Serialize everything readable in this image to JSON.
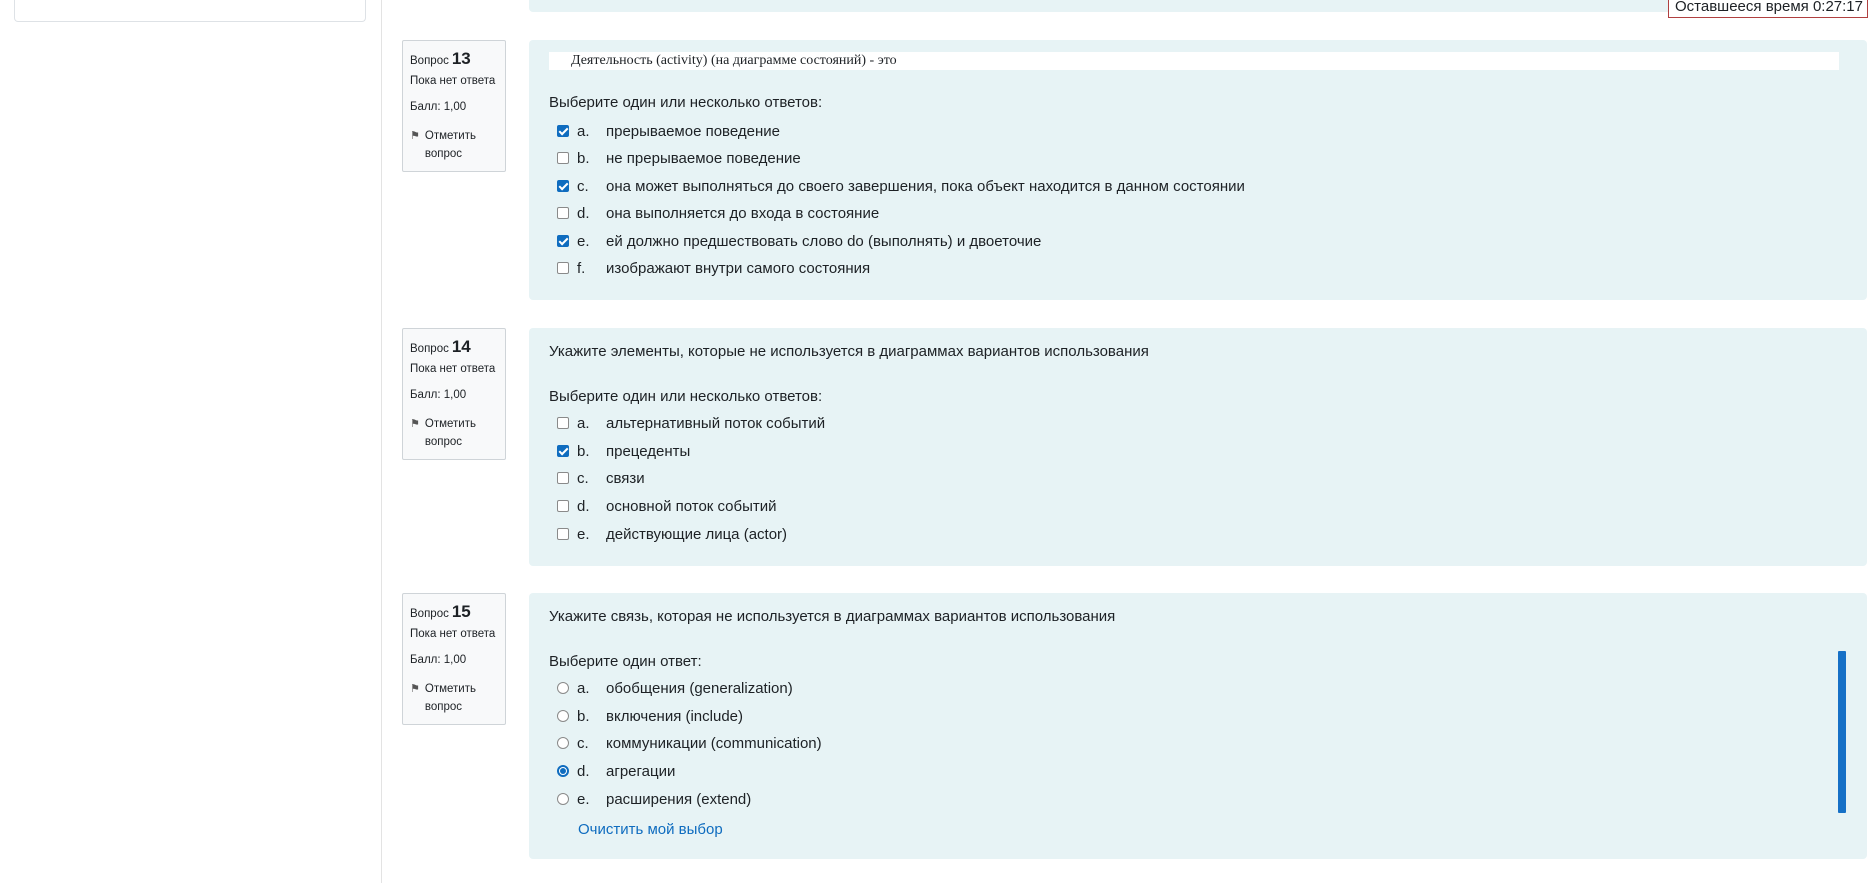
{
  "timer": {
    "label": "Оставшееся время 0:27:17"
  },
  "questions": [
    {
      "word": "Вопрос",
      "number": "13",
      "status": "Пока нет ответа",
      "grade": "Балл: 1,00",
      "flag_line1": "Отметить",
      "flag_line2": "вопрос",
      "text": "Деятельность (activity) (на диаграмме состояний) - это",
      "prompt": "Выберите один или несколько ответов:",
      "options": [
        {
          "letter": "a.",
          "text": "прерываемое поведение",
          "checked": true
        },
        {
          "letter": "b.",
          "text": "не прерываемое поведение",
          "checked": false
        },
        {
          "letter": "c.",
          "text": "она может выполняться до своего завершения, пока объект находится в данном состоянии",
          "checked": true
        },
        {
          "letter": "d.",
          "text": "она выполняется до входа в состояние",
          "checked": false
        },
        {
          "letter": "e.",
          "text": "ей должно предшествовать слово do (выполнять) и двоеточие",
          "checked": true
        },
        {
          "letter": "f.",
          "text": "изображают внутри самого состояния",
          "checked": false
        }
      ]
    },
    {
      "word": "Вопрос",
      "number": "14",
      "status": "Пока нет ответа",
      "grade": "Балл: 1,00",
      "flag_line1": "Отметить",
      "flag_line2": "вопрос",
      "text": "Укажите элементы, которые не используется в диаграммах вариантов использования",
      "prompt": "Выберите один или несколько ответов:",
      "options": [
        {
          "letter": "a.",
          "text": "альтернативный поток событий",
          "checked": false
        },
        {
          "letter": "b.",
          "text": "прецеденты",
          "checked": true
        },
        {
          "letter": "c.",
          "text": "связи",
          "checked": false
        },
        {
          "letter": "d.",
          "text": "основной поток событий",
          "checked": false
        },
        {
          "letter": "e.",
          "text": "действующие лица (actor)",
          "checked": false
        }
      ]
    },
    {
      "word": "Вопрос",
      "number": "15",
      "status": "Пока нет ответа",
      "grade": "Балл: 1,00",
      "flag_line1": "Отметить",
      "flag_line2": "вопрос",
      "text": "Укажите связь, которая не используется в диаграммах вариантов использования",
      "prompt": "Выберите один ответ:",
      "options": [
        {
          "letter": "a.",
          "text": "обобщения (generalization)",
          "checked": false
        },
        {
          "letter": "b.",
          "text": "включения (include)",
          "checked": false
        },
        {
          "letter": "c.",
          "text": "коммуникации (communication)",
          "checked": false
        },
        {
          "letter": "d.",
          "text": "агрегации",
          "checked": true
        },
        {
          "letter": "e.",
          "text": "расширения (extend)",
          "checked": false
        }
      ],
      "clear_label": "Очистить мой выбор"
    }
  ],
  "icons": {
    "flag": "flag-icon"
  },
  "colors": {
    "accent": "#0f6cbf",
    "panel_bg": "#e7f3f5",
    "timer_border": "#b04040"
  }
}
